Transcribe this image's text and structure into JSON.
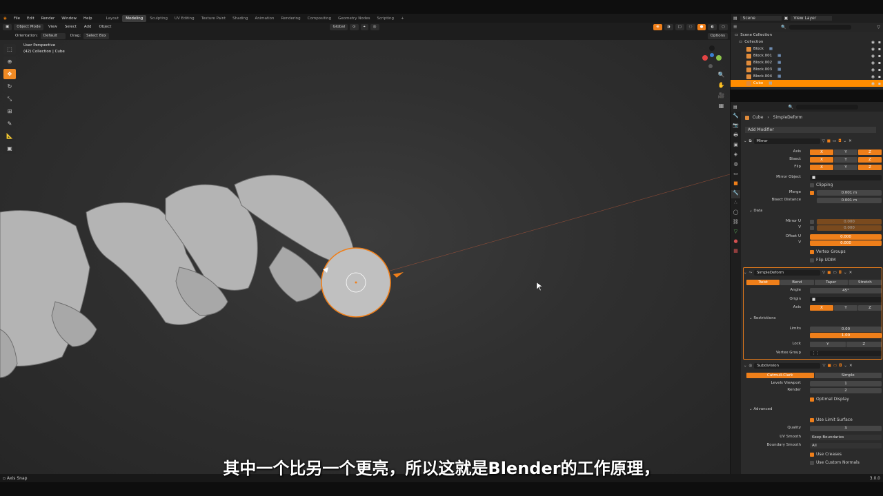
{
  "menu": [
    "File",
    "Edit",
    "Render",
    "Window",
    "Help"
  ],
  "workspaces": [
    "Layout",
    "Modeling",
    "Sculpting",
    "UV Editing",
    "Texture Paint",
    "Shading",
    "Animation",
    "Rendering",
    "Compositing",
    "Geometry Nodes",
    "Scripting"
  ],
  "active_workspace": "Modeling",
  "scene": "Scene",
  "view_layer": "View Layer",
  "viewport_header": {
    "mode": "Object Mode",
    "menus": [
      "View",
      "Select",
      "Add",
      "Object"
    ],
    "transform": "Global",
    "orientation_label": "Orientation:",
    "orientation_value": "Default",
    "drag_label": "Drag:",
    "drag_value": "Select Box",
    "options": "Options"
  },
  "viewport_info": {
    "line1": "User Perspective",
    "line2": "(42) Collection | Cube"
  },
  "outliner": {
    "root": "Scene Collection",
    "collection": "Collection",
    "items": [
      {
        "name": "Block",
        "selected": false
      },
      {
        "name": "Block.001",
        "selected": false
      },
      {
        "name": "Block.002",
        "selected": false
      },
      {
        "name": "Block.003",
        "selected": false
      },
      {
        "name": "Block.004",
        "selected": false
      },
      {
        "name": "Cube",
        "selected": true
      }
    ]
  },
  "properties": {
    "breadcrumb_object": "Cube",
    "breadcrumb_modifier": "SimpleDeform",
    "add_modifier": "Add Modifier",
    "mirror": {
      "name": "Mirror",
      "axis_label": "Axis",
      "bisect_label": "Bisect",
      "flip_label": "Flip",
      "mirror_object_label": "Mirror Object",
      "clipping": "Clipping",
      "merge_label": "Merge",
      "merge_value": "0.001 m",
      "bisect_distance_label": "Bisect Distance",
      "bisect_distance_value": "0.001 m",
      "data_section": "Data",
      "mirror_u_label": "Mirror U",
      "mirror_u_value": "0.000",
      "v_label": "V",
      "mirror_v_value": "0.000",
      "offset_u_label": "Offset U",
      "offset_u_value": "0.000",
      "offset_v_value": "0.000",
      "vertex_groups": "Vertex Groups",
      "flip_udim": "Flip UDIM"
    },
    "simple_deform": {
      "name": "SimpleDeform",
      "modes": [
        "Twist",
        "Bend",
        "Taper",
        "Stretch"
      ],
      "active_mode": "Twist",
      "angle_label": "Angle",
      "angle_value": "45°",
      "origin_label": "Origin",
      "axis_label": "Axis",
      "restrictions": "Restrictions",
      "limits_label": "Limits",
      "limit_low": "0.00",
      "limit_high": "1.00",
      "lock_label": "Lock",
      "vertex_group_label": "Vertex Group"
    },
    "subdivision": {
      "name": "Subdivision",
      "modes": [
        "Catmull-Clark",
        "Simple"
      ],
      "levels_viewport_label": "Levels Viewport",
      "levels_viewport_value": "1",
      "render_label": "Render",
      "render_value": "2",
      "optimal_display": "Optimal Display",
      "advanced": "Advanced",
      "use_limit_surface": "Use Limit Surface",
      "quality_label": "Quality",
      "quality_value": "3",
      "uv_smooth_label": "UV Smooth",
      "uv_smooth_value": "Keep Boundaries",
      "boundary_smooth_label": "Boundary Smooth",
      "boundary_smooth_value": "All",
      "use_creases": "Use Creases",
      "use_custom_normals": "Use Custom Normals"
    }
  },
  "axes": [
    "X",
    "Y",
    "Z"
  ],
  "status": {
    "left": "Axis Snap",
    "version": "3.0.0"
  },
  "subtitle": "其中一个比另一个更亮，所以这就是Blender的工作原理，",
  "colors": {
    "accent": "#ef7f1a",
    "selection": "#ff8c00"
  }
}
